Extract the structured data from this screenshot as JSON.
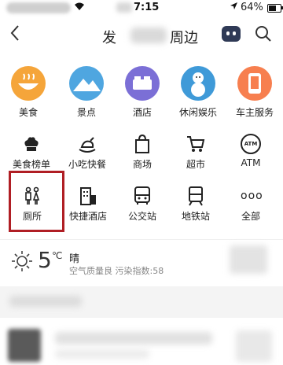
{
  "status_bar": {
    "time": "7:15",
    "battery": "64%"
  },
  "header": {
    "title_left": "发",
    "title_right": "周边"
  },
  "categories_top": [
    {
      "label": "美食",
      "icon": "food-bowl-icon"
    },
    {
      "label": "景点",
      "icon": "mountain-icon"
    },
    {
      "label": "酒店",
      "icon": "hotel-bed-icon"
    },
    {
      "label": "休闲娱乐",
      "icon": "snowman-icon"
    },
    {
      "label": "车主服务",
      "icon": "phone-icon"
    }
  ],
  "categories_row2": [
    {
      "label": "美食榜单",
      "icon": "chef-hat-icon"
    },
    {
      "label": "小吃快餐",
      "icon": "roast-chicken-icon"
    },
    {
      "label": "商场",
      "icon": "shopping-bag-icon"
    },
    {
      "label": "超市",
      "icon": "shopping-cart-icon"
    },
    {
      "label": "ATM",
      "icon": "atm-icon"
    }
  ],
  "categories_row3": [
    {
      "label": "厕所",
      "icon": "toilet-icon"
    },
    {
      "label": "快捷酒店",
      "icon": "building-icon"
    },
    {
      "label": "公交站",
      "icon": "bus-icon"
    },
    {
      "label": "地铁站",
      "icon": "subway-icon"
    },
    {
      "label": "全部",
      "icon": "more-dots-icon"
    }
  ],
  "weather": {
    "temperature": "5",
    "unit": "℃",
    "condition": "晴",
    "air_quality": "空气质量良 污染指数:58"
  },
  "atm_glyph": "ATM",
  "more_glyph": "ooo"
}
